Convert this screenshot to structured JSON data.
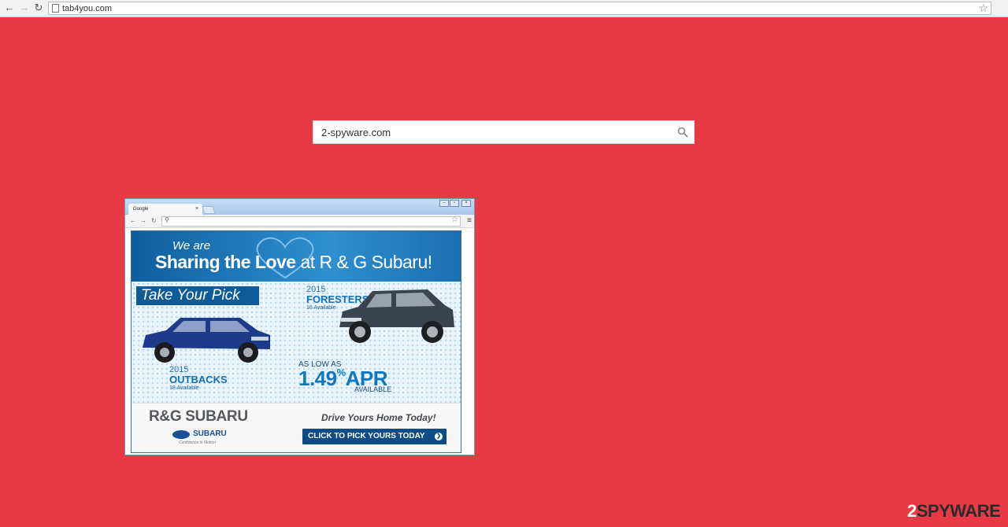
{
  "browser": {
    "url": "tab4you.com",
    "nav_back": "←",
    "nav_forward": "→",
    "nav_reload": "↻",
    "star": "☆"
  },
  "search": {
    "value": "2-spyware.com"
  },
  "popup": {
    "tab_label": "Google",
    "tab_close": "×",
    "menu": "≡",
    "ad": {
      "intro": "We are",
      "headline_bold": "Sharing the Love",
      "headline_rest": " at R & G Subaru!",
      "take_pick": "Take Your Pick",
      "forester_year": "2015",
      "forester_model": "FORESTERS",
      "forester_avail": "16 Available",
      "outback_year": "2015",
      "outback_model": "OUTBACKS",
      "outback_avail": "18 Available",
      "as_low_as": "AS LOW AS",
      "rate": "1.49",
      "rate_pct": "%",
      "rate_apr": "APR",
      "available": "AVAILABLE",
      "dealer": "R&G SUBARU",
      "subaru": "SUBARU",
      "tagline": "Confidence in Motion",
      "drive": "Drive Yours Home Today!",
      "cta": "CLICK TO PICK YOURS TODAY"
    }
  },
  "watermark": {
    "num": "2",
    "text": "SPYWARE"
  },
  "colors": {
    "background": "#e83a45",
    "ad_blue": "#0d5c99",
    "cta_blue": "#0d4c86"
  }
}
